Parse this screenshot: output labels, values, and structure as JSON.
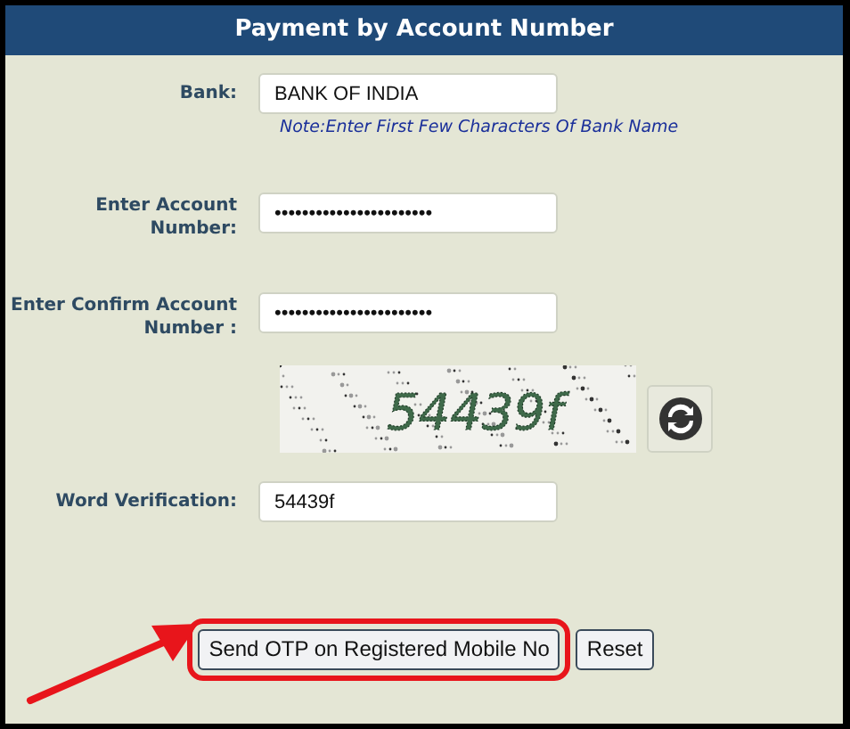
{
  "panel": {
    "title": "Payment by Account Number"
  },
  "fields": [
    {
      "kind": "text",
      "label": "Bank:",
      "value": "BANK OF INDIA",
      "note": "Note:Enter First Few Characters Of Bank Name"
    },
    {
      "kind": "text",
      "label": "Enter Account Number:",
      "value": "•••••••••••••••••••••••"
    },
    {
      "kind": "text",
      "label": "Enter Confirm Account Number :",
      "value": "•••••••••••••••••••••••"
    },
    {
      "kind": "captcha",
      "captcha_text": "54439f"
    },
    {
      "kind": "text",
      "label": "Word Verification:",
      "value": "54439f"
    }
  ],
  "buttons": [
    {
      "label": "Send OTP on Registered Mobile No",
      "highlighted": true
    },
    {
      "label": "Reset",
      "highlighted": false
    }
  ]
}
